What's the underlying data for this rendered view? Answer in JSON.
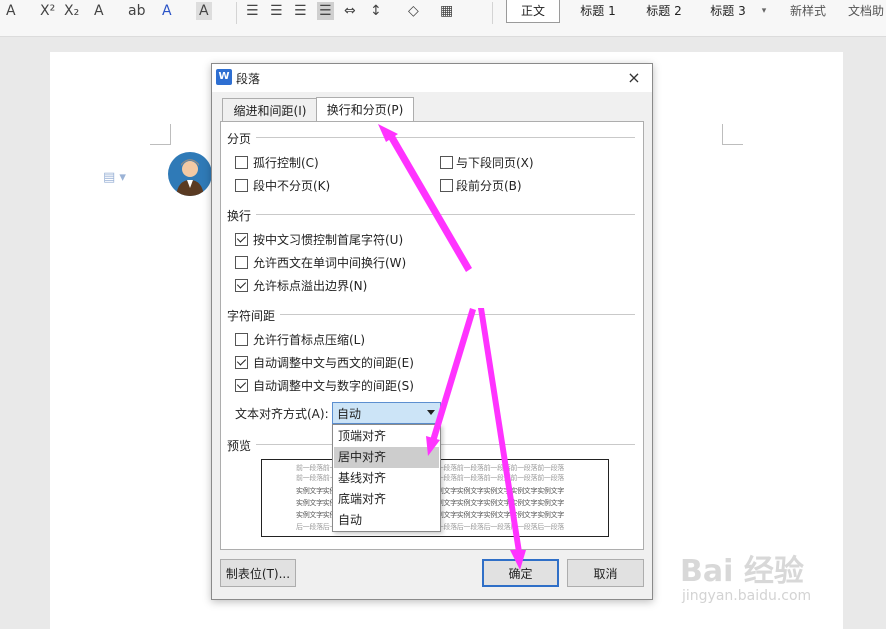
{
  "ribbon": {
    "styles": [
      "正文",
      "标题 1",
      "标题 2",
      "标题 3"
    ],
    "new_style": "新样式",
    "doc_helper": "文档助"
  },
  "dialog": {
    "title": "段落",
    "close_glyph": "×",
    "tabs": [
      "缩进和间距(I)",
      "换行和分页(P)"
    ],
    "sections": {
      "pagination": "分页",
      "line_break": "换行",
      "char_spacing": "字符间距",
      "preview": "预览"
    },
    "checkboxes": [
      {
        "label": "孤行控制(C)",
        "checked": false
      },
      {
        "label": "与下段同页(X)",
        "checked": false
      },
      {
        "label": "段中不分页(K)",
        "checked": false
      },
      {
        "label": "段前分页(B)",
        "checked": false
      },
      {
        "label": "按中文习惯控制首尾字符(U)",
        "checked": true
      },
      {
        "label": "允许西文在单词中间换行(W)",
        "checked": false
      },
      {
        "label": "允许标点溢出边界(N)",
        "checked": true
      },
      {
        "label": "允许行首标点压缩(L)",
        "checked": false
      },
      {
        "label": "自动调整中文与西文的间距(E)",
        "checked": true
      },
      {
        "label": "自动调整中文与数字的间距(S)",
        "checked": true
      }
    ],
    "text_align_label": "文本对齐方式(A):",
    "text_align_value": "自动",
    "dropdown_options": [
      "顶端对齐",
      "居中对齐",
      "基线对齐",
      "底端对齐",
      "自动"
    ],
    "dropdown_highlighted": "居中对齐",
    "preview_lines": [
      "前一段落前一段落前一段落前一段落前一段落前一段落前一段落前一段落前一段落前一段落",
      "前一段落前一段落前一段落前一段落前一段落前一段落前一段落前一段落前一段落前一段落",
      "实例文字实例文字实例文字实例文字实例文字实例文字实例文字实例文字实例文字实例文字",
      "实例文字实例文字实例文字实例文字实例文字实例文字实例文字实例文字实例文字实例文字",
      "实例文字实例文字实例文字实例文字实例文字实例文字实例文字实例文字实例文字实例文字",
      "后一段落后一段落后一段落后一段落后一段落后一段落后一段落后一段落后一段落后一段落"
    ],
    "buttons": {
      "tabs": "制表位(T)...",
      "ok": "确定",
      "cancel": "取消"
    }
  },
  "watermark": {
    "brand": "Bai 经验",
    "url": "jingyan.baidu.com"
  },
  "colors": {
    "arrow": "#ff33ff",
    "select_bg": "#cce4f7",
    "accent": "#2f6fc7"
  }
}
